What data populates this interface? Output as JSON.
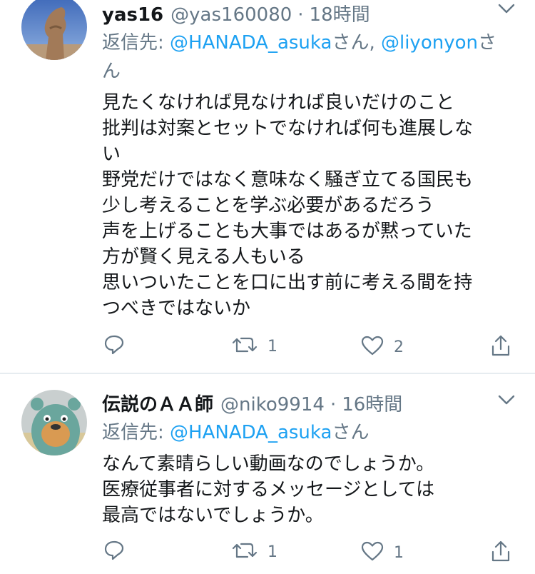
{
  "tweets": [
    {
      "name": "yas16",
      "handle": "@yas160080",
      "separator": "·",
      "time": "18時間",
      "reply_prefix": "返信先: ",
      "reply_mentions": [
        "@HANADA_asuka",
        "@liyonyon"
      ],
      "reply_suffix_1": "さん, ",
      "reply_suffix_2": "さ",
      "reply_wrap": "ん",
      "lines": [
        "見たくなければ見なければ良いだけのこと",
        "批判は対案とセットでなければ何も進展しな",
        "い",
        "野党だけではなく意味なく騒ぎ立てる国民も",
        "少し考えることを学ぶ必要があるだろう",
        "声を上げることも大事ではあるが黙っていた",
        "方が賢く見える人もいる",
        "思いついたことを口に出す前に考える間を持",
        "つべきではないか"
      ],
      "retweets": "1",
      "likes": "2"
    },
    {
      "name": "伝説のＡＡ師",
      "handle": "@niko9914",
      "separator": "·",
      "time": "16時間",
      "reply_prefix": "返信先: ",
      "reply_mention": "@HANADA_asuka",
      "reply_suffix": "さん",
      "lines": [
        "なんて素晴らしい動画なのでしょうか。",
        "医療従事者に対するメッセージとしては",
        "最高ではないでしょうか。"
      ],
      "retweets": "1",
      "likes": "1"
    }
  ],
  "icons": {
    "reply": "reply-icon",
    "retweet": "retweet-icon",
    "like": "heart-icon",
    "share": "share-icon",
    "menu": "chevron-down-icon"
  },
  "colors": {
    "link": "#1da1f2",
    "secondary": "#657786",
    "divider": "#e6ecf0"
  }
}
